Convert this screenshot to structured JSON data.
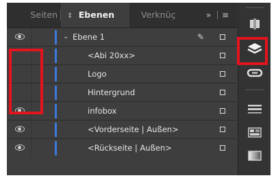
{
  "tabs": {
    "seiten": "Seiten",
    "ebenen": "Ebenen",
    "verknuepfungen": "Verknüç",
    "more": "»",
    "menu": "≡"
  },
  "layers": [
    {
      "name": "Ebene 1",
      "visible": true,
      "expanded": true,
      "level": 0,
      "has_pen": true
    },
    {
      "name": "<Abi 20xx>",
      "visible": false,
      "level": 1
    },
    {
      "name": "Logo",
      "visible": false,
      "level": 1
    },
    {
      "name": "Hintergrund",
      "visible": false,
      "level": 1
    },
    {
      "name": "infobox",
      "visible": true,
      "level": 1
    },
    {
      "name": "<Vorderseite | Außen>",
      "visible": true,
      "level": 1
    },
    {
      "name": "<Rückseite | Außen>",
      "visible": true,
      "level": 1
    }
  ],
  "side_panel": [
    "cc-libraries-icon",
    "layers-icon",
    "links-icon",
    "stroke-icon",
    "swatches-icon",
    "gradient-icon"
  ],
  "colors": {
    "layer_color": "#3b7be0",
    "highlight": "#e3141e",
    "panel_bg": "#3e3e3e"
  }
}
